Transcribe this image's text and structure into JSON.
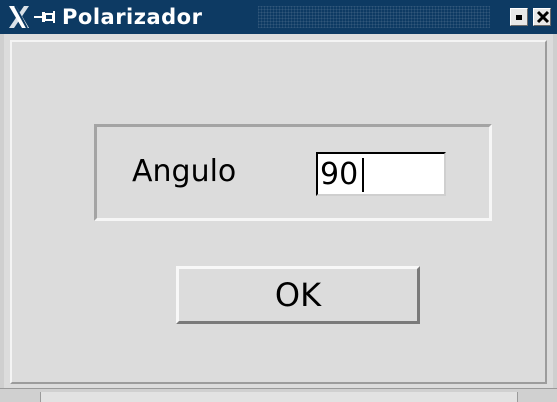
{
  "window": {
    "title": "Polarizador",
    "logo_icon": "x-window-logo-icon",
    "pin_icon": "pin-icon",
    "titlebar_color": "#0d3a63"
  },
  "titlebar_buttons": {
    "minimize_icon": "minimize-icon",
    "close_icon": "close-icon"
  },
  "form": {
    "angle_label": "Angulo",
    "angle_value": "90"
  },
  "actions": {
    "ok_label": "OK"
  }
}
